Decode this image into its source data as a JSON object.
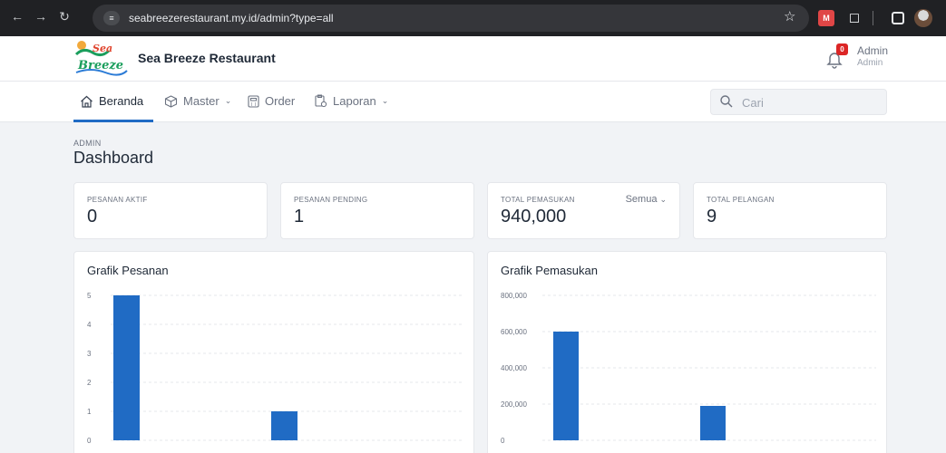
{
  "browser": {
    "url": "seabreezerestaurant.my.id/admin?type=all",
    "colors": {
      "chrome_bg": "#202124",
      "url_bg": "#35363a"
    }
  },
  "app": {
    "brand_name": "Sea Breeze Restaurant",
    "logo_text": "Sea Breeze",
    "notification_count": "0",
    "user_name": "Admin",
    "user_role": "Admin"
  },
  "nav": {
    "items": [
      {
        "label": "Beranda",
        "icon": "home-icon",
        "dropdown": false,
        "active": true
      },
      {
        "label": "Master",
        "icon": "box-icon",
        "dropdown": true,
        "active": false
      },
      {
        "label": "Order",
        "icon": "calculator-icon",
        "dropdown": false,
        "active": false
      },
      {
        "label": "Laporan",
        "icon": "report-icon",
        "dropdown": true,
        "active": false
      }
    ],
    "search_placeholder": "Cari"
  },
  "page": {
    "pretitle": "ADMIN",
    "title": "Dashboard"
  },
  "stats": [
    {
      "label": "PESANAN AKTIF",
      "value": "0"
    },
    {
      "label": "PESANAN PENDING",
      "value": "1"
    },
    {
      "label": "TOTAL PEMASUKAN",
      "value": "940,000",
      "filter": "Semua"
    },
    {
      "label": "TOTAL PELANGAN",
      "value": "9"
    }
  ],
  "colors": {
    "accent": "#206bc4",
    "bar": "#206bc4",
    "badge": "#dc2626"
  },
  "chart_data": [
    {
      "type": "bar",
      "title": "Grafik Pesanan",
      "y_ticks": [
        "0",
        "1",
        "2",
        "3",
        "4",
        "5"
      ],
      "ylim": [
        0,
        5
      ],
      "values": [
        5,
        0,
        0,
        1,
        0,
        0,
        0
      ],
      "grid": true
    },
    {
      "type": "bar",
      "title": "Grafik Pemasukan",
      "y_ticks": [
        "0",
        "200,000",
        "400,000",
        "600,000",
        "800,000"
      ],
      "ylim": [
        0,
        800000
      ],
      "values": [
        600000,
        0,
        0,
        190000,
        0,
        0,
        0
      ],
      "grid": true
    }
  ]
}
